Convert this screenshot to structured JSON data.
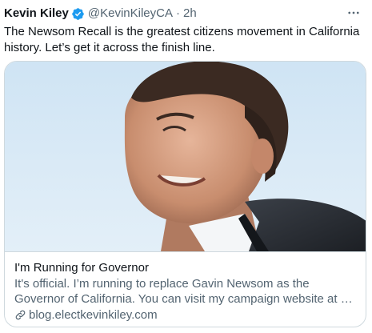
{
  "tweet": {
    "author_name": "Kevin Kiley",
    "handle": "@KevinKileyCA",
    "separator": "·",
    "time": "2h",
    "verified_icon": "verified-badge-icon",
    "more_icon": "more-horizontal-icon",
    "text": "The Newsom Recall is the greatest citizens movement in California history. Let’s get it across the finish line."
  },
  "card": {
    "image_subject": "photo-of-man-smiling",
    "title": "I'm Running for Governor",
    "description": "It's official. I’m running to replace Gavin Newsom as the Governor of California. You can visit my campaign website at …",
    "link_icon": "link-icon",
    "domain": "blog.electkevinkiley.com"
  },
  "colors": {
    "text_primary": "#0f1419",
    "text_secondary": "#536471",
    "verified_blue": "#1d9bf0",
    "border": "#cfd9de"
  }
}
